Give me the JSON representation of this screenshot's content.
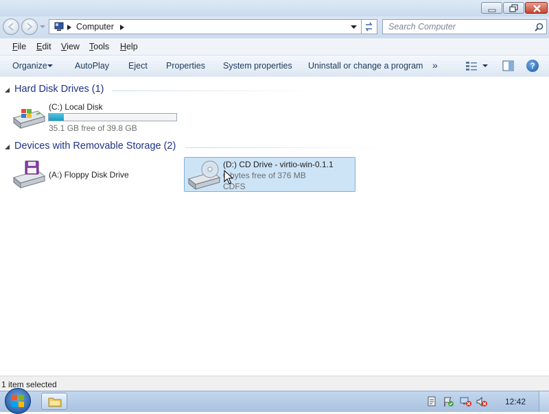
{
  "window": {
    "caption_buttons": [
      "minimize-icon",
      "maximize-icon",
      "close-icon"
    ]
  },
  "address": {
    "location": "Computer",
    "search_placeholder": "Search Computer"
  },
  "menu": {
    "items": [
      {
        "label": "File",
        "underline": "F",
        "rest": "ile"
      },
      {
        "label": "Edit",
        "underline": "E",
        "rest": "dit"
      },
      {
        "label": "View",
        "underline": "V",
        "rest": "iew"
      },
      {
        "label": "Tools",
        "underline": "T",
        "rest": "ools"
      },
      {
        "label": "Help",
        "underline": "H",
        "rest": "elp"
      }
    ]
  },
  "commands": {
    "organize": "Organize",
    "autoplay": "AutoPlay",
    "eject": "Eject",
    "properties": "Properties",
    "system_properties": "System properties",
    "uninstall": "Uninstall or change a program",
    "more": "»",
    "help": "?"
  },
  "groups": {
    "hdd": {
      "title": "Hard Disk Drives (1)",
      "items": [
        {
          "label": "(C:) Local Disk",
          "free_text": "35.1 GB free of 39.8 GB",
          "used_fraction": 0.118,
          "icon": "hard-disk-icon"
        }
      ]
    },
    "removable": {
      "title": "Devices with Removable Storage (2)",
      "items": [
        {
          "label": "(A:) Floppy Disk Drive",
          "icon": "floppy-drive-icon"
        },
        {
          "label": "(D:) CD Drive - virtio-win-0.1.1",
          "free_text": "0 bytes free of 376 MB",
          "fs": "CDFS",
          "icon": "cd-drive-icon",
          "selected": true
        }
      ]
    }
  },
  "status": {
    "text": "1 item selected"
  },
  "taskbar": {
    "clock": "12:42",
    "tray_icons": [
      "action-center-icon",
      "flag-icon",
      "network-icon",
      "volume-muted-icon"
    ]
  },
  "colors": {
    "group_header": "#1e3287",
    "selection_bg": "#cde4f7",
    "selection_border": "#84acdd",
    "disk_bar_fill": "#1a9bc0"
  }
}
